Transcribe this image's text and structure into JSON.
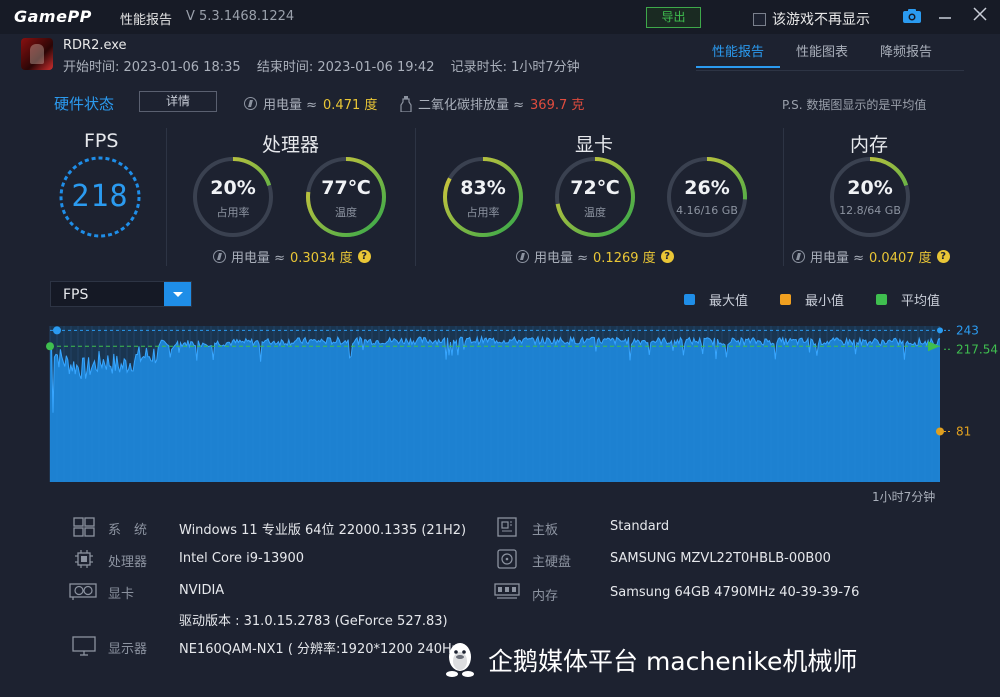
{
  "app": {
    "logo": "GamePP",
    "title": "性能报告",
    "version": "V 5.3.1468.1224",
    "export_label": "导出",
    "no_display_label": "该游戏不再显示"
  },
  "game": {
    "name": "RDR2.exe",
    "start": "开始时间: 2023-01-06 18:35",
    "end": "结束时间: 2023-01-06 19:42",
    "duration": "记录时长: 1小时7分钟"
  },
  "tabs": [
    {
      "label": "性能报告",
      "active": true
    },
    {
      "label": "性能图表",
      "active": false
    },
    {
      "label": "降频报告",
      "active": false
    }
  ],
  "hardware_state": {
    "title": "硬件状态",
    "detail_label": "详情",
    "power_label": "用电量 ≈",
    "power_value": "0.471 度",
    "co2_label": "二氧化碳排放量 ≈",
    "co2_value": "369.7 克",
    "note": "P.S. 数据图显示的是平均值"
  },
  "fps": {
    "title": "FPS",
    "value": "218"
  },
  "cpu": {
    "title": "处理器",
    "usage": {
      "value": "20%",
      "label": "占用率",
      "fraction": 0.2
    },
    "temp": {
      "value": "77℃",
      "label": "温度",
      "fraction": 0.77
    },
    "power_label": "用电量 ≈",
    "power_value": "0.3034 度"
  },
  "gpu": {
    "title": "显卡",
    "usage": {
      "value": "83%",
      "label": "占用率",
      "fraction": 0.83
    },
    "temp": {
      "value": "72℃",
      "label": "温度",
      "fraction": 0.72
    },
    "vram": {
      "value": "26%",
      "label": "4.16/16 GB",
      "fraction": 0.26
    },
    "power_label": "用电量 ≈",
    "power_value": "0.1269 度"
  },
  "memory": {
    "title": "内存",
    "usage": {
      "value": "20%",
      "label": "12.8/64 GB",
      "fraction": 0.2
    },
    "power_label": "用电量 ≈",
    "power_value": "0.0407 度"
  },
  "chart_selector": {
    "value": "FPS"
  },
  "legend": [
    {
      "label": "最大值",
      "color": "#1f8ee8"
    },
    {
      "label": "最小值",
      "color": "#f0a020"
    },
    {
      "label": "平均值",
      "color": "#3fbf4f"
    }
  ],
  "chart_data": {
    "type": "area",
    "series_name": "FPS",
    "ylim": [
      0,
      250
    ],
    "max": 243,
    "min": 81,
    "avg": 217.54,
    "max_label": "243",
    "min_label": "81",
    "avg_label": "217.54",
    "duration_label": "1小时7分钟",
    "profile": [
      {
        "t": 0.0,
        "fps": 220
      },
      {
        "t": 0.01,
        "fps": 200
      },
      {
        "t": 0.02,
        "fps": 190
      },
      {
        "t": 0.04,
        "fps": 180
      },
      {
        "t": 0.06,
        "fps": 195
      },
      {
        "t": 0.08,
        "fps": 185
      },
      {
        "t": 0.1,
        "fps": 200
      },
      {
        "t": 0.12,
        "fps": 205
      },
      {
        "t": 0.14,
        "fps": 222
      },
      {
        "t": 0.3,
        "fps": 226
      },
      {
        "t": 0.5,
        "fps": 227
      },
      {
        "t": 0.7,
        "fps": 226
      },
      {
        "t": 0.9,
        "fps": 225
      },
      {
        "t": 1.0,
        "fps": 224
      }
    ]
  },
  "system": {
    "os_label": "系　统",
    "os_value": "Windows 11 专业版 64位 22000.1335 (21H2)",
    "cpu_label": "处理器",
    "cpu_value": "Intel Core i9-13900",
    "gpu_label": "显卡",
    "gpu_value": "NVIDIA",
    "driver_value": "驱动版本 : 31.0.15.2783 (GeForce 527.83)",
    "display_label": "显示器",
    "display_value": "NE160QAM-NX1 ( 分辨率:1920*1200 240Hz)",
    "mb_label": "主板",
    "mb_value": "Standard",
    "disk_label": "主硬盘",
    "disk_value": "SAMSUNG MZVL22T0HBLB-00B00",
    "mem_label": "内存",
    "mem_value": "Samsung 64GB 4790MHz 40-39-39-76"
  },
  "watermark": {
    "text": "企鹅媒体平台 machenike机械师"
  }
}
